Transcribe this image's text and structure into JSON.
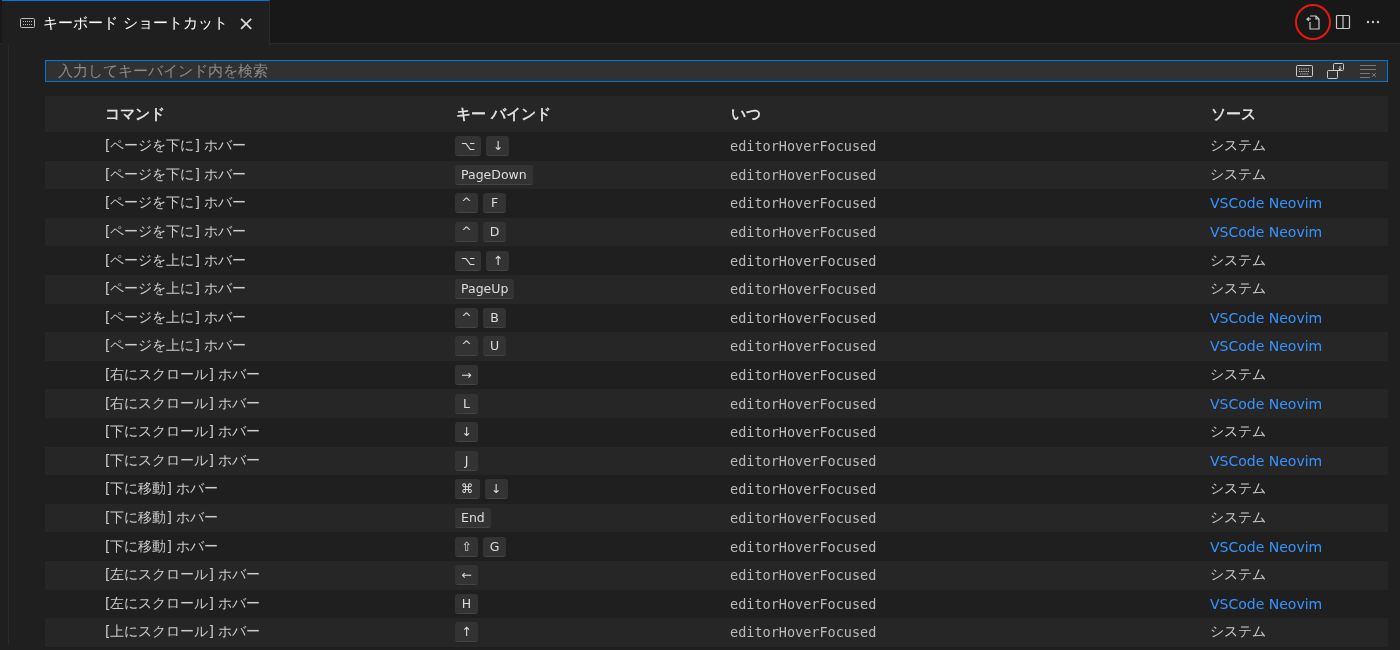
{
  "tab": {
    "title": "キーボード ショートカット",
    "close": "×",
    "selected": true
  },
  "toolbar": [
    {
      "kind": "open-json",
      "highlighted": true
    },
    {
      "kind": "split",
      "highlighted": false
    },
    {
      "kind": "more",
      "highlighted": false
    }
  ],
  "search": {
    "placeholder": "入力してキーバインド内を検索"
  },
  "table": {
    "columns": [
      "コマンド",
      "キー バインド",
      "いつ",
      "ソース"
    ],
    "rows": [
      {
        "command": "[ページを下に] ホバー",
        "keys": [
          "⌥",
          "↓"
        ],
        "when": "editorHoverFocused",
        "source": "システム",
        "kind": "system"
      },
      {
        "command": "[ページを下に] ホバー",
        "keys": [
          "PageDown"
        ],
        "when": "editorHoverFocused",
        "source": "システム",
        "kind": "system"
      },
      {
        "command": "[ページを下に] ホバー",
        "keys": [
          "^",
          "F"
        ],
        "when": "editorHoverFocused",
        "source": "VSCode Neovim",
        "kind": "extension"
      },
      {
        "command": "[ページを下に] ホバー",
        "keys": [
          "^",
          "D"
        ],
        "when": "editorHoverFocused",
        "source": "VSCode Neovim",
        "kind": "extension"
      },
      {
        "command": "[ページを上に] ホバー",
        "keys": [
          "⌥",
          "↑"
        ],
        "when": "editorHoverFocused",
        "source": "システム",
        "kind": "system"
      },
      {
        "command": "[ページを上に] ホバー",
        "keys": [
          "PageUp"
        ],
        "when": "editorHoverFocused",
        "source": "システム",
        "kind": "system"
      },
      {
        "command": "[ページを上に] ホバー",
        "keys": [
          "^",
          "B"
        ],
        "when": "editorHoverFocused",
        "source": "VSCode Neovim",
        "kind": "extension"
      },
      {
        "command": "[ページを上に] ホバー",
        "keys": [
          "^",
          "U"
        ],
        "when": "editorHoverFocused",
        "source": "VSCode Neovim",
        "kind": "extension"
      },
      {
        "command": "[右にスクロール] ホバー",
        "keys": [
          "→"
        ],
        "when": "editorHoverFocused",
        "source": "システム",
        "kind": "system"
      },
      {
        "command": "[右にスクロール] ホバー",
        "keys": [
          "L"
        ],
        "when": "editorHoverFocused",
        "source": "VSCode Neovim",
        "kind": "extension"
      },
      {
        "command": "[下にスクロール] ホバー",
        "keys": [
          "↓"
        ],
        "when": "editorHoverFocused",
        "source": "システム",
        "kind": "system"
      },
      {
        "command": "[下にスクロール] ホバー",
        "keys": [
          "J"
        ],
        "when": "editorHoverFocused",
        "source": "VSCode Neovim",
        "kind": "extension"
      },
      {
        "command": "[下に移動] ホバー",
        "keys": [
          "⌘",
          "↓"
        ],
        "when": "editorHoverFocused",
        "source": "システム",
        "kind": "system"
      },
      {
        "command": "[下に移動] ホバー",
        "keys": [
          "End"
        ],
        "when": "editorHoverFocused",
        "source": "システム",
        "kind": "system"
      },
      {
        "command": "[下に移動] ホバー",
        "keys": [
          "⇧",
          "G"
        ],
        "when": "editorHoverFocused",
        "source": "VSCode Neovim",
        "kind": "extension"
      },
      {
        "command": "[左にスクロール] ホバー",
        "keys": [
          "←"
        ],
        "when": "editorHoverFocused",
        "source": "システム",
        "kind": "system"
      },
      {
        "command": "[左にスクロール] ホバー",
        "keys": [
          "H"
        ],
        "when": "editorHoverFocused",
        "source": "VSCode Neovim",
        "kind": "extension"
      },
      {
        "command": "[上にスクロール] ホバー",
        "keys": [
          "↑"
        ],
        "when": "editorHoverFocused",
        "source": "システム",
        "kind": "system"
      }
    ]
  }
}
